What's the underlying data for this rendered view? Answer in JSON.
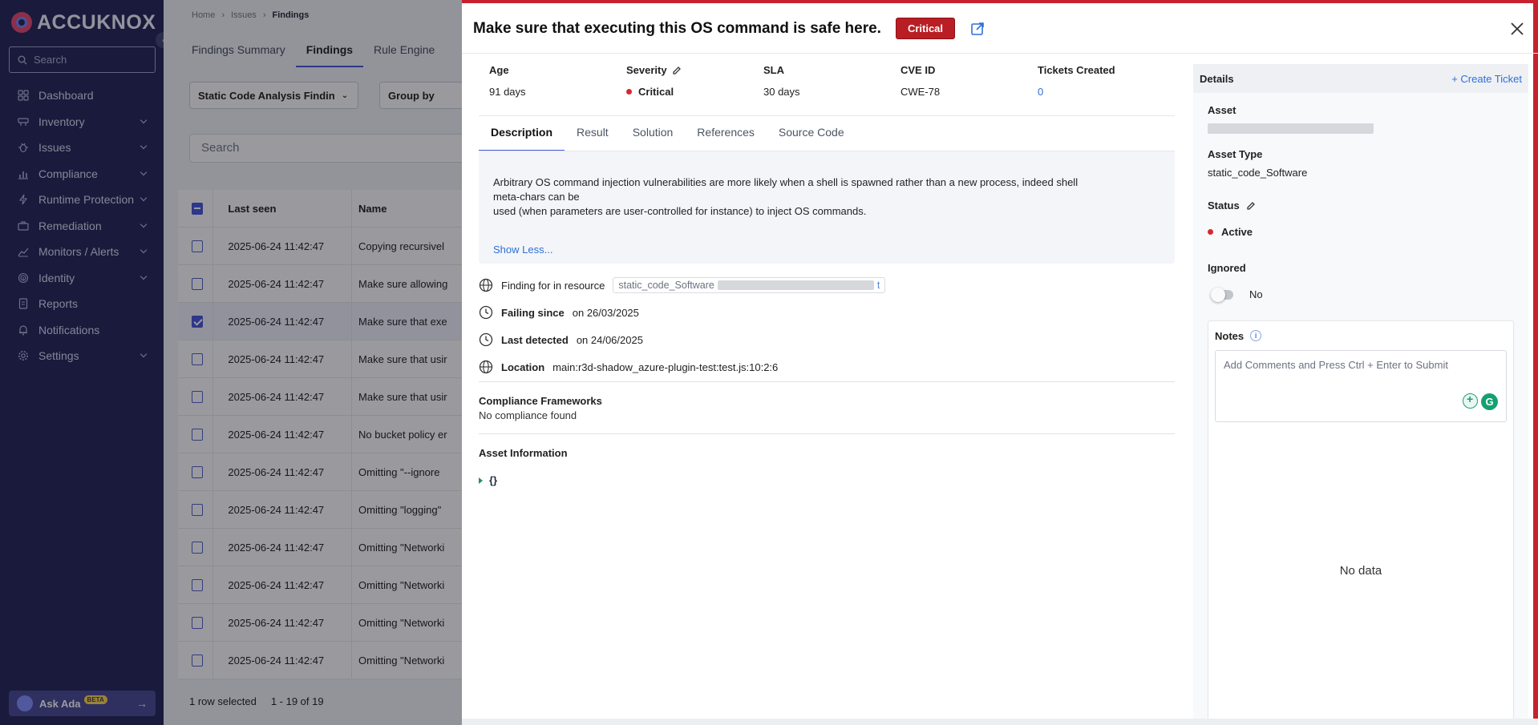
{
  "sidebar": {
    "logo_text": "ACCUKNOX",
    "search_placeholder": "Search",
    "items": [
      {
        "label": "Dashboard",
        "icon": "grid-icon",
        "has_children": false
      },
      {
        "label": "Inventory",
        "icon": "inventory-icon",
        "has_children": true
      },
      {
        "label": "Issues",
        "icon": "bug-icon",
        "has_children": true
      },
      {
        "label": "Compliance",
        "icon": "chart-icon",
        "has_children": true
      },
      {
        "label": "Runtime Protection",
        "icon": "bolt-icon",
        "has_children": true
      },
      {
        "label": "Remediation",
        "icon": "toolbox-icon",
        "has_children": true
      },
      {
        "label": "Monitors / Alerts",
        "icon": "line-chart-icon",
        "has_children": true
      },
      {
        "label": "Identity",
        "icon": "fingerprint-icon",
        "has_children": true
      },
      {
        "label": "Reports",
        "icon": "document-icon",
        "has_children": false
      },
      {
        "label": "Notifications",
        "icon": "bell-icon",
        "has_children": false
      },
      {
        "label": "Settings",
        "icon": "gear-icon",
        "has_children": true
      }
    ],
    "ask_ada": {
      "label": "Ask Ada",
      "beta": "BETA"
    }
  },
  "main": {
    "breadcrumb": [
      "Home",
      "Issues",
      "Findings"
    ],
    "tabs": [
      "Findings Summary",
      "Findings",
      "Rule Engine"
    ],
    "active_tab": "Findings",
    "filter_data_type": "Static Code Analysis Findin",
    "filter_group_by": "Group by",
    "search_placeholder": "Search",
    "table": {
      "headers": [
        "Last seen",
        "Name"
      ],
      "rows": [
        {
          "last_seen": "2025-06-24 11:42:47",
          "name": "Copying recursivel",
          "checked": false
        },
        {
          "last_seen": "2025-06-24 11:42:47",
          "name": "Make sure allowing",
          "checked": false
        },
        {
          "last_seen": "2025-06-24 11:42:47",
          "name": "Make sure that exe",
          "checked": true
        },
        {
          "last_seen": "2025-06-24 11:42:47",
          "name": "Make sure that usir",
          "checked": false
        },
        {
          "last_seen": "2025-06-24 11:42:47",
          "name": "Make sure that usir",
          "checked": false
        },
        {
          "last_seen": "2025-06-24 11:42:47",
          "name": "No bucket policy er",
          "checked": false
        },
        {
          "last_seen": "2025-06-24 11:42:47",
          "name": "Omitting \"--ignore",
          "checked": false
        },
        {
          "last_seen": "2025-06-24 11:42:47",
          "name": "Omitting \"logging\"",
          "checked": false
        },
        {
          "last_seen": "2025-06-24 11:42:47",
          "name": "Omitting \"Networki",
          "checked": false
        },
        {
          "last_seen": "2025-06-24 11:42:47",
          "name": "Omitting \"Networki",
          "checked": false
        },
        {
          "last_seen": "2025-06-24 11:42:47",
          "name": "Omitting \"Networki",
          "checked": false
        },
        {
          "last_seen": "2025-06-24 11:42:47",
          "name": "Omitting \"Networki",
          "checked": false
        }
      ]
    },
    "footer": {
      "selected": "1 row selected",
      "range": "1 - 19 of 19"
    }
  },
  "drawer": {
    "title": "Make sure that executing this OS command is safe here.",
    "severity_badge": "Critical",
    "meta": {
      "age_label": "Age",
      "age_value": "91 days",
      "severity_label": "Severity",
      "severity_value": "Critical",
      "sla_label": "SLA",
      "sla_value": "30 days",
      "cve_label": "CVE ID",
      "cve_value": "CWE-78",
      "tickets_label": "Tickets Created",
      "tickets_value": "0"
    },
    "tabs": [
      "Description",
      "Result",
      "Solution",
      "References",
      "Source Code"
    ],
    "active_tab": "Description",
    "description_line1": "Arbitrary OS command injection vulnerabilities are more likely when a shell is spawned rather than a new process, indeed shell",
    "description_line2": "meta-chars can be",
    "description_line3": "used (when parameters are user-controlled for instance) to inject OS commands.",
    "show_less": "Show Less...",
    "finding_label": "Finding for in resource",
    "resource_prefix": "static_code_Software",
    "resource_suffix": "t",
    "failing_label": "Failing since",
    "failing_value": "on 26/03/2025",
    "detected_label": "Last detected",
    "detected_value": "on 24/06/2025",
    "location_label": "Location",
    "location_value": "main:r3d-shadow_azure-plugin-test:test.js:10:2:6",
    "compliance_title": "Compliance Frameworks",
    "compliance_value": "No compliance found",
    "asset_info_title": "Asset Information",
    "asset_info_value": "{}",
    "details": {
      "title": "Details",
      "create_ticket": "+ Create Ticket",
      "asset_label": "Asset",
      "asset_type_label": "Asset Type",
      "asset_type_value": "static_code_Software",
      "status_label": "Status",
      "status_value": "Active",
      "ignored_label": "Ignored",
      "ignored_value": "No",
      "notes_label": "Notes",
      "notes_placeholder": "Add Comments and Press Ctrl + Enter to Submit",
      "no_data": "No data"
    }
  },
  "colors": {
    "sidebar_bg": "#17174f",
    "critical": "#b81e24",
    "accent": "#3b4bd8",
    "link": "#2f6fd8"
  }
}
